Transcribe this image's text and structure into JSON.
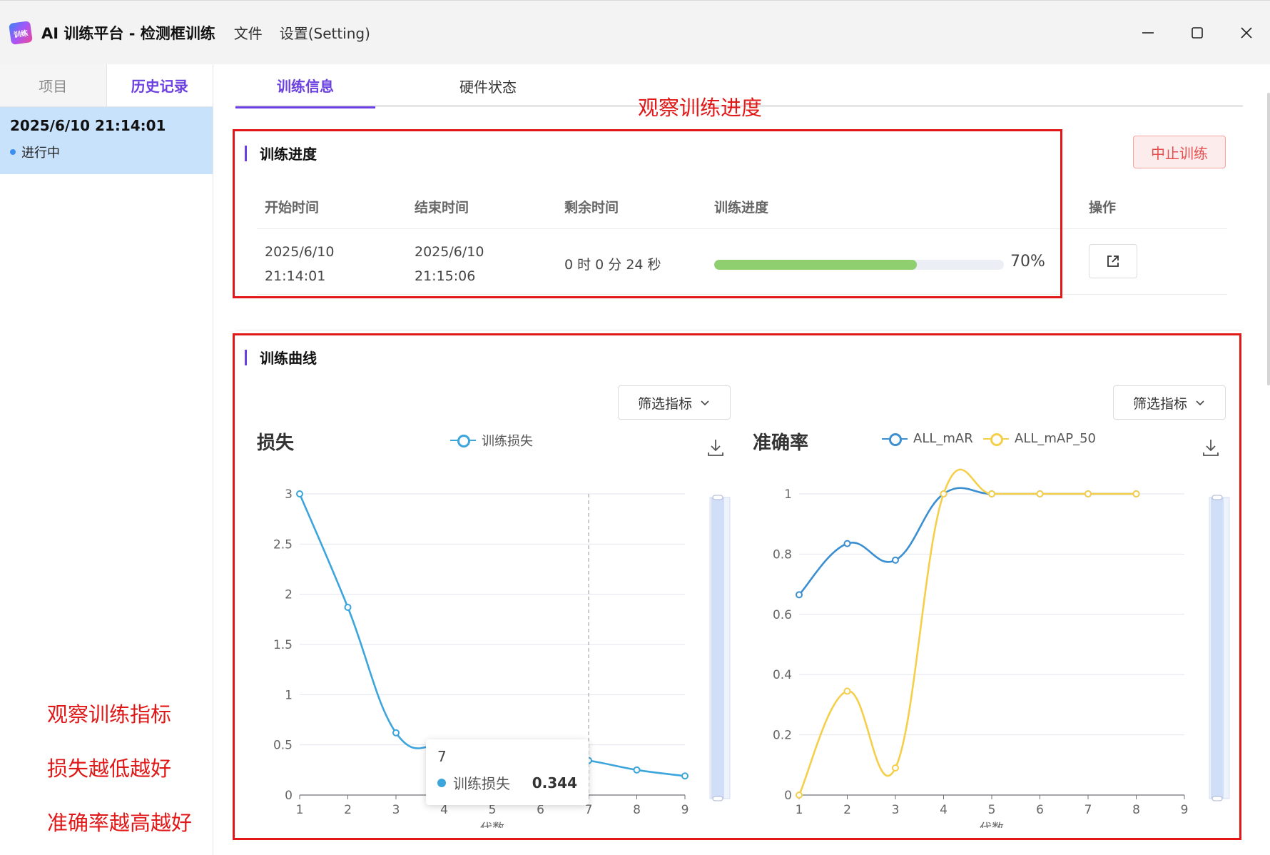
{
  "window": {
    "app_title": "AI 训练平台 - 检测框训练",
    "logo_text": "训练",
    "menu": [
      "文件",
      "设置(Setting)"
    ]
  },
  "sidebar": {
    "tabs": [
      "项目",
      "历史记录"
    ],
    "active_tab": 1,
    "history": [
      {
        "date": "2025/6/10 21:14:01",
        "status": "进行中"
      }
    ],
    "notes": [
      "观察训练指标",
      "损失越低越好",
      "准确率越高越好"
    ]
  },
  "main": {
    "tabs": [
      "训练信息",
      "硬件状态"
    ],
    "active_tab": 0,
    "note_progress": "观察训练进度",
    "progress_section": {
      "title": "训练进度",
      "stop_label": "中止训练",
      "columns": [
        "开始时间",
        "结束时间",
        "剩余时间",
        "训练进度",
        "操作"
      ],
      "row": {
        "start": [
          "2025/6/10",
          "21:14:01"
        ],
        "end": [
          "2025/6/10",
          "21:15:06"
        ],
        "remaining": "0 时 0 分 24 秒",
        "progress_value": 70,
        "progress_text": "70%"
      }
    },
    "curve_section": {
      "title": "训练曲线",
      "filter_label": "筛选指标"
    },
    "tooltip": {
      "x": "7",
      "series": "训练损失",
      "value": "0.344"
    }
  },
  "colors": {
    "accent": "#6b3fe0",
    "loss": "#3ba5dc",
    "mar": "#3b8fd0",
    "map50": "#f5cf4a",
    "progress": "#8fcf70",
    "annotation": "#e01818"
  },
  "chart_data": [
    {
      "type": "line",
      "title": "损失",
      "xlabel": "代数",
      "ylabel": "",
      "x": [
        1,
        2,
        3,
        4,
        5,
        6,
        7,
        8,
        9
      ],
      "xlim": [
        1,
        9
      ],
      "ylim": [
        0,
        3
      ],
      "yticks": [
        0,
        0.5,
        1,
        1.5,
        2,
        2.5,
        3
      ],
      "series": [
        {
          "name": "训练损失",
          "x": [
            1,
            2,
            3,
            4,
            5,
            6,
            7,
            8,
            9
          ],
          "values": [
            3.0,
            1.87,
            0.62,
            0.5,
            0.5,
            0.4,
            0.344,
            0.25,
            0.19
          ]
        }
      ],
      "hover_x": 7,
      "grid": true,
      "legend": "top"
    },
    {
      "type": "line",
      "title": "准确率",
      "xlabel": "代数",
      "ylabel": "",
      "x": [
        1,
        2,
        3,
        4,
        5,
        6,
        7,
        8,
        9
      ],
      "xlim": [
        1,
        9
      ],
      "ylim": [
        0,
        1
      ],
      "yticks": [
        0,
        0.2,
        0.4,
        0.6,
        0.8,
        1
      ],
      "series": [
        {
          "name": "ALL_mAR",
          "x": [
            1,
            2,
            3,
            4,
            5,
            6,
            7,
            8
          ],
          "values": [
            0.665,
            0.835,
            0.78,
            1.0,
            1.0,
            1.0,
            1.0,
            1.0
          ]
        },
        {
          "name": "ALL_mAP_50",
          "x": [
            1,
            2,
            3,
            4,
            5,
            6,
            7,
            8
          ],
          "values": [
            0.0,
            0.345,
            0.09,
            1.0,
            1.0,
            1.0,
            1.0,
            1.0
          ]
        }
      ],
      "grid": true,
      "legend": "top"
    }
  ]
}
